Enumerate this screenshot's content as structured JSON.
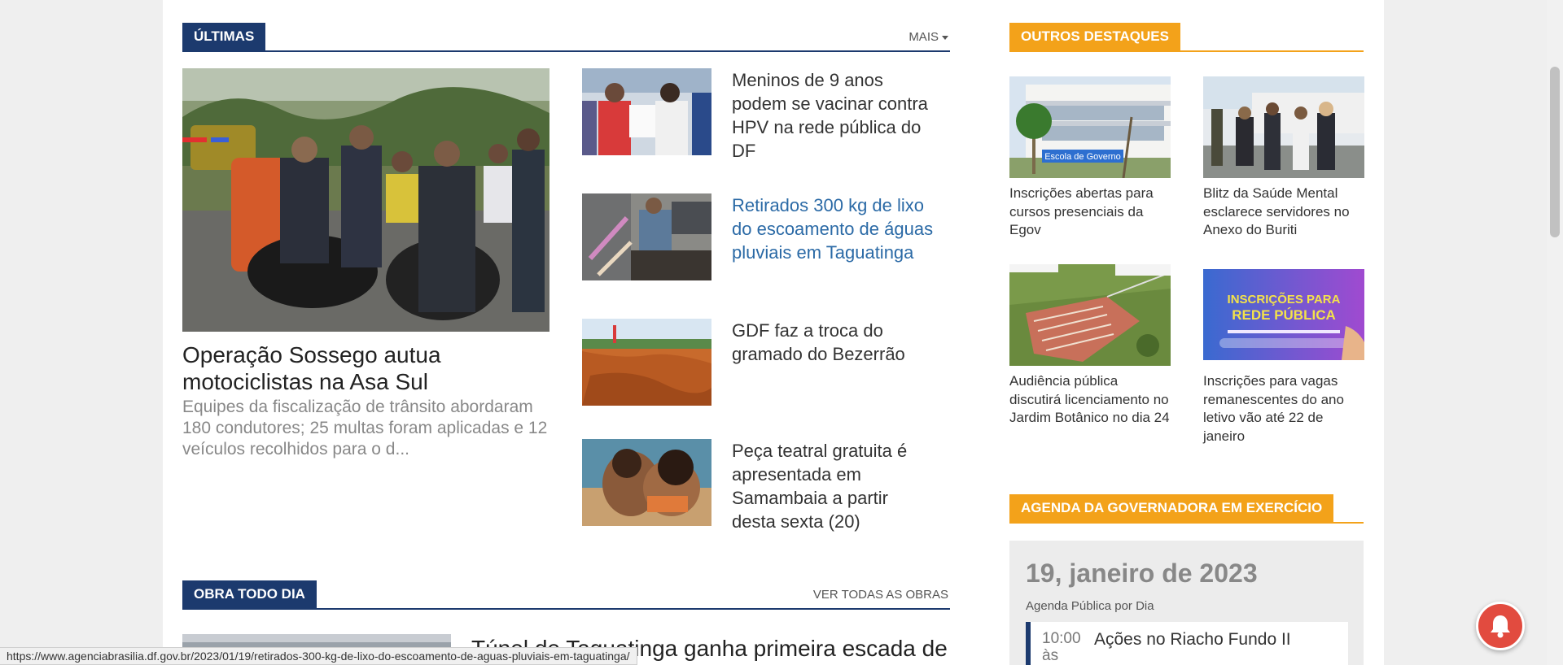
{
  "ultimas": {
    "label": "ÚLTIMAS",
    "more_label": "MAIS",
    "feature": {
      "title": "Operação Sossego autua motociclistas na Asa Sul",
      "description": "Equipes da fiscalização de trânsito abordaram 180 condutores; 25 multas foram aplicadas e 12 veículos recolhidos para o d..."
    },
    "items": [
      {
        "title": "Meninos de 9 anos podem se vacinar contra HPV na rede pública do DF"
      },
      {
        "title": "Retirados 300 kg de lixo do escoamento de águas pluviais em Taguatinga"
      },
      {
        "title": "GDF faz a troca do gramado do Bezerrão"
      },
      {
        "title": "Peça teatral gratuita é apresentada em Samambaia a partir desta sexta (20)"
      }
    ]
  },
  "outros": {
    "label": "OUTROS DESTAQUES",
    "items": [
      {
        "title": "Inscrições abertas para cursos presenciais da Egov",
        "image_text": "Escola de Governo"
      },
      {
        "title": "Blitz da Saúde Mental esclarece servidores no Anexo do Buriti"
      },
      {
        "title": "Audiência pública discutirá licenciamento no Jardim Botânico no dia 24"
      },
      {
        "title": "Inscrições para vagas remanescentes do ano letivo vão até 22 de janeiro",
        "image_text_1": "INSCRIÇÕES PARA",
        "image_text_2": "REDE PÚBLICA"
      }
    ]
  },
  "agenda": {
    "label": "AGENDA DA GOVERNADORA EM EXERCÍCIO",
    "date": "19, janeiro de 2023",
    "subtitle": "Agenda Pública por Dia",
    "item_time": "10:00",
    "item_time_suffix": "às",
    "item_title": "Ações no Riacho Fundo II"
  },
  "obra": {
    "label": "OBRA TODO DIA",
    "more_label": "VER TODAS AS OBRAS",
    "title": "Túnel de Taguatinga ganha primeira escada de"
  },
  "status_url": "https://www.agenciabrasilia.df.gov.br/2023/01/19/retirados-300-kg-de-lixo-do-escoamento-de-aguas-pluviais-em-taguatinga/",
  "colors": {
    "navy": "#1c3a6e",
    "orange": "#f3a21a",
    "link_blue": "#2b6aa6",
    "bell_red": "#e24b3f"
  },
  "icons": {
    "bell": "bell-icon",
    "caret": "caret-down-icon"
  }
}
